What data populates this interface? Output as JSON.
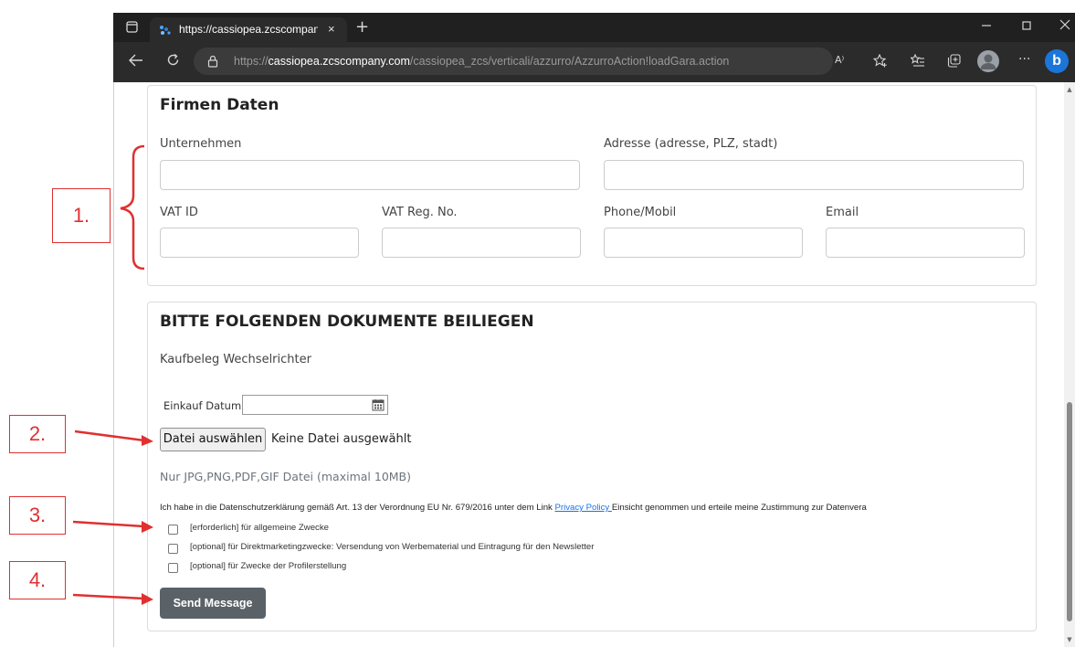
{
  "browser": {
    "tab_title": "https://cassiopea.zcscompany.co",
    "tab_close_glyph": "×",
    "new_tab_glyph": "+",
    "url_prefix": "https://",
    "url_host": "cassiopea.zcscompany.com",
    "url_path": "/cassiopea_zcs/verticali/azzurro/AzzurroAction!loadGara.action",
    "read_aloud_label": "A⁾",
    "more_glyph": "···",
    "bing_label": "b"
  },
  "company": {
    "title": "Firmen Daten",
    "fields": {
      "company_label": "Unternehmen",
      "address_label": "Adresse (adresse, PLZ, stadt)",
      "vat_label": "VAT ID",
      "vatreg_label": "VAT Reg. No.",
      "phone_label": "Phone/Mobil",
      "email_label": "Email"
    }
  },
  "documents": {
    "title": "BITTE FOLGENDEN DOKUMENTE BEILIEGEN",
    "receipt_label": "Kaufbeleg Wechselrichter",
    "date_label": "Einkauf Datum",
    "file_button_label": "Datei auswählen",
    "file_status": "Keine Datei ausgewählt",
    "file_note": "Nur JPG,PNG,PDF,GIF Datei (maximal 10MB)",
    "consent_before": "Ich habe in die Datenschutzerklärung gemäß Art. 13 der Verordnung EU Nr. 679/2016 unter dem Link ",
    "consent_link": "Privacy Policy ",
    "consent_after": "Einsicht genommen und erteile meine Zustimmung zur Datenvera",
    "checkboxes": [
      {
        "label": "[erforderlich] für allgemeine Zwecke",
        "checked": false
      },
      {
        "label": "[optional] für Direktmarketingzwecke: Versendung von Werbematerial und Eintragung für den Newsletter",
        "checked": false
      },
      {
        "label": "[optional] für Zwecke der Profilerstellung",
        "checked": false
      }
    ],
    "send_label": "Send Message"
  },
  "annotations": {
    "a1": "1.",
    "a2": "2.",
    "a3": "3.",
    "a4": "4.",
    "color": "#e03030"
  },
  "colors": {
    "titlebar": "#202020",
    "toolbar": "#2b2b2b",
    "link": "#1a73e8",
    "send_button": "#5a6268"
  }
}
